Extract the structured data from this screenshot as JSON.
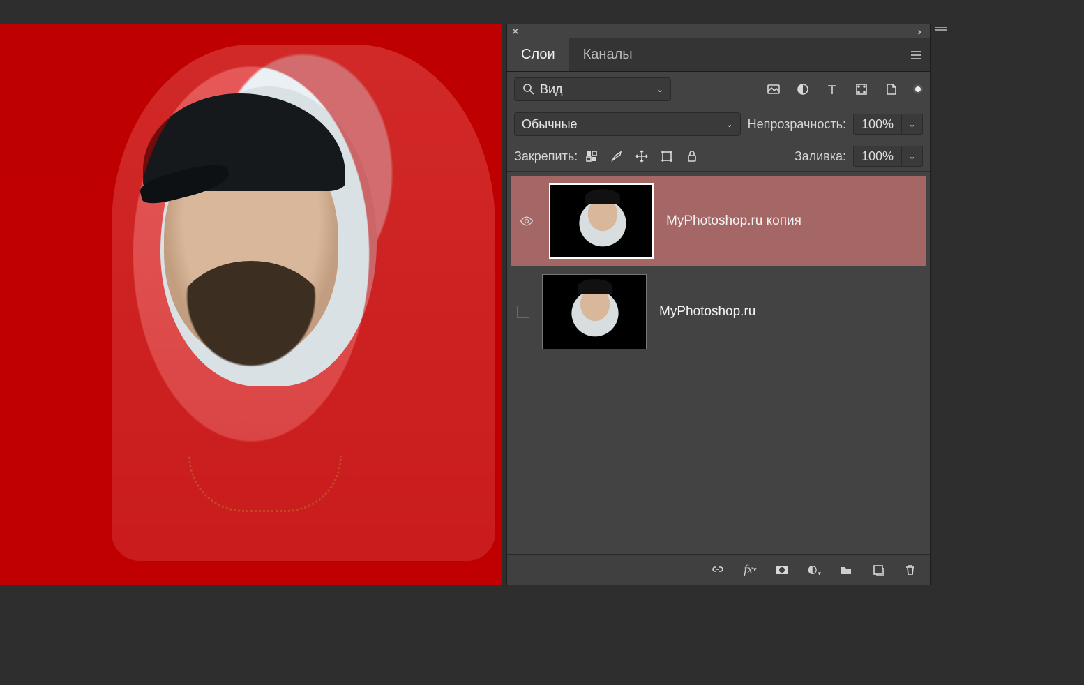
{
  "tabs": {
    "layers": "Слои",
    "channels": "Каналы"
  },
  "filter": {
    "search_label": "Вид",
    "search_icon": "search",
    "types": [
      "image",
      "adjustment",
      "type",
      "shape",
      "smart-object"
    ]
  },
  "blend": {
    "mode": "Обычные",
    "opacity_label": "Непрозрачность:",
    "opacity_value": "100%"
  },
  "lock": {
    "label": "Закрепить:",
    "fill_label": "Заливка:",
    "fill_value": "100%"
  },
  "layers": [
    {
      "name": "MyPhotoshop.ru копия",
      "visible": true,
      "selected": true
    },
    {
      "name": "MyPhotoshop.ru",
      "visible": false,
      "selected": false
    }
  ],
  "footer_icons": [
    "link",
    "fx",
    "mask",
    "adjustment",
    "group",
    "new-layer",
    "trash"
  ]
}
